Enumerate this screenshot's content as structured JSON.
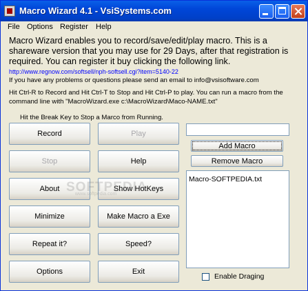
{
  "window": {
    "title": "Macro Wizard 4.1 - VsiSystems.com"
  },
  "menu": [
    "File",
    "Options",
    "Register",
    "Help"
  ],
  "intro": "Macro Wizard enables you to record/save/edit/play macro.  This is a shareware version that you may use for 29 Days, after that registration is required. You can register it buy clicking the following link.",
  "register_link": "http://www.regnow.com/softsell/nph-softsell.cgi?item=5140-22",
  "contact": "If you have any problems or questions please send an email to info@vsisoftware.com",
  "hotkeys_note": "Hit Ctrl-R to Record and Hit Ctrl-T to Stop and Hit Ctrl-P to play.  You can run a macro from the command line with \"MacroWizard.exe c:\\MacroWizard\\Maco-NAME.txt\"",
  "break_note": "Hit the Break Key to Stop a Marco from Running.",
  "buttons": {
    "record": "Record",
    "play": "Play",
    "stop": "Stop",
    "help": "Help",
    "about": "About",
    "show_hotkeys": "Show HotKeys",
    "minimize": "Minimize",
    "make_exe": "Make Macro a Exe",
    "repeat": "Repeat it?",
    "speed": "Speed?",
    "options": "Options",
    "exit": "Exit",
    "add_macro": "Add Macro",
    "remove_macro": "Remove Macro"
  },
  "macro_name_input": {
    "value": ""
  },
  "macro_list": [
    "Macro-SOFTPEDIA.txt"
  ],
  "enable_drag": {
    "label": "Enable Draging",
    "checked": false
  },
  "watermark": {
    "text": "SOFTPEDIA",
    "sub": "www.softpedia.com"
  }
}
